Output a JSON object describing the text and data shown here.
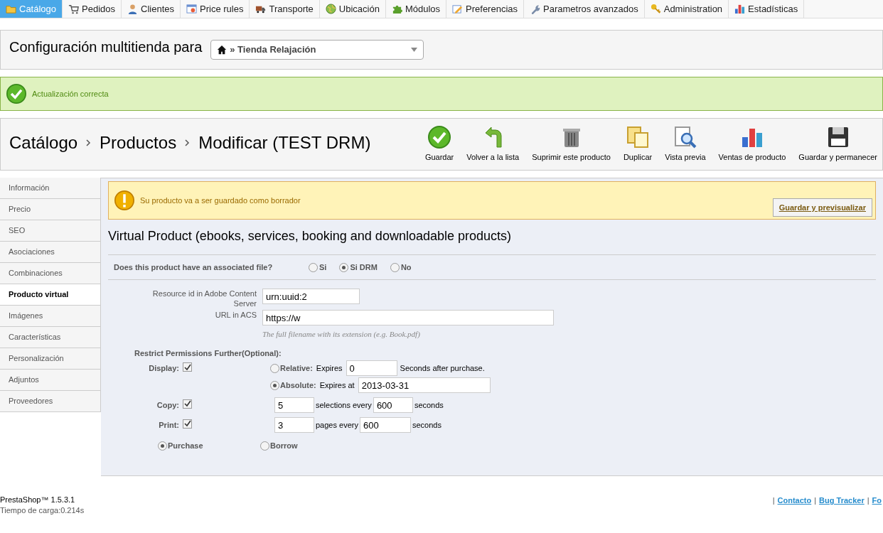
{
  "nav_tabs": [
    {
      "label": "Catálogo",
      "selected": true
    },
    {
      "label": "Pedidos",
      "selected": false
    },
    {
      "label": "Clientes",
      "selected": false
    },
    {
      "label": "Price rules",
      "selected": false
    },
    {
      "label": "Transporte",
      "selected": false
    },
    {
      "label": "Ubicación",
      "selected": false
    },
    {
      "label": "Módulos",
      "selected": false
    },
    {
      "label": "Preferencias",
      "selected": false
    },
    {
      "label": "Parametros avanzados",
      "selected": false
    },
    {
      "label": "Administration",
      "selected": false
    },
    {
      "label": "Estadísticas",
      "selected": false
    }
  ],
  "multistore": {
    "label": "Configuración multitienda para",
    "shop": "» Tienda Relajación"
  },
  "success": "Actualización correcta",
  "breadcrumb": [
    "Catálogo",
    "Productos",
    "Modificar (TEST DRM)"
  ],
  "toolbar": [
    {
      "label": "Guardar"
    },
    {
      "label": "Volver a la lista"
    },
    {
      "label": "Suprimir este producto"
    },
    {
      "label": "Duplicar"
    },
    {
      "label": "Vista previa"
    },
    {
      "label": "Ventas de producto"
    },
    {
      "label": "Guardar y permanecer"
    }
  ],
  "sidebar": [
    {
      "label": "Información",
      "selected": false
    },
    {
      "label": "Precio",
      "selected": false
    },
    {
      "label": "SEO",
      "selected": false
    },
    {
      "label": "Asociaciones",
      "selected": false
    },
    {
      "label": "Combinaciones",
      "selected": false
    },
    {
      "label": "Producto virtual",
      "selected": true
    },
    {
      "label": "Imágenes",
      "selected": false
    },
    {
      "label": "Características",
      "selected": false
    },
    {
      "label": "Personalización",
      "selected": false
    },
    {
      "label": "Adjuntos",
      "selected": false
    },
    {
      "label": "Proveedores",
      "selected": false
    }
  ],
  "warning": {
    "text": "Su producto va a ser guardado como borrador",
    "button": "Guardar y previsualizar"
  },
  "section_title": "Virtual Product (ebooks, services, booking and downloadable products)",
  "file_question": {
    "label": "Does this product have an associated file?",
    "options": [
      {
        "label": "Si",
        "selected": false
      },
      {
        "label": "Si DRM",
        "selected": true
      },
      {
        "label": "No",
        "selected": false
      }
    ]
  },
  "resource_id": {
    "label": "Resource id in Adobe Content Server",
    "value": "urn:uuid:2"
  },
  "url_acs": {
    "label": "URL in ACS",
    "value": "https://w",
    "hint": "The full filename with its extension (e.g. Book.pdf)"
  },
  "permissions_title": "Restrict Permissions Further(Optional):",
  "display": {
    "label": "Display:",
    "checked": true,
    "relative": {
      "label": "Relative:",
      "selected": false,
      "prefix": "Expires",
      "value": "0",
      "suffix": "Seconds after purchase."
    },
    "absolute": {
      "label": "Absolute:",
      "selected": true,
      "prefix": "Expires at",
      "value": "2013-03-31"
    }
  },
  "copy": {
    "label": "Copy:",
    "checked": true,
    "count": "5",
    "middle": "selections every",
    "seconds": "600",
    "suffix": "seconds"
  },
  "print": {
    "label": "Print:",
    "checked": true,
    "count": "3",
    "middle": "pages every",
    "seconds": "600",
    "suffix": "seconds"
  },
  "mode": [
    {
      "label": "Purchase",
      "selected": true
    },
    {
      "label": "Borrow",
      "selected": false
    }
  ],
  "footer": {
    "version": "PrestaShop™ 1.5.3.1",
    "load_time": "Tiempo de carga:0.214s",
    "links": [
      {
        "separator": "|",
        "label": "Contacto"
      },
      {
        "separator": "|",
        "label": "Bug Tracker"
      },
      {
        "separator": "|",
        "label": "Fo"
      }
    ]
  }
}
